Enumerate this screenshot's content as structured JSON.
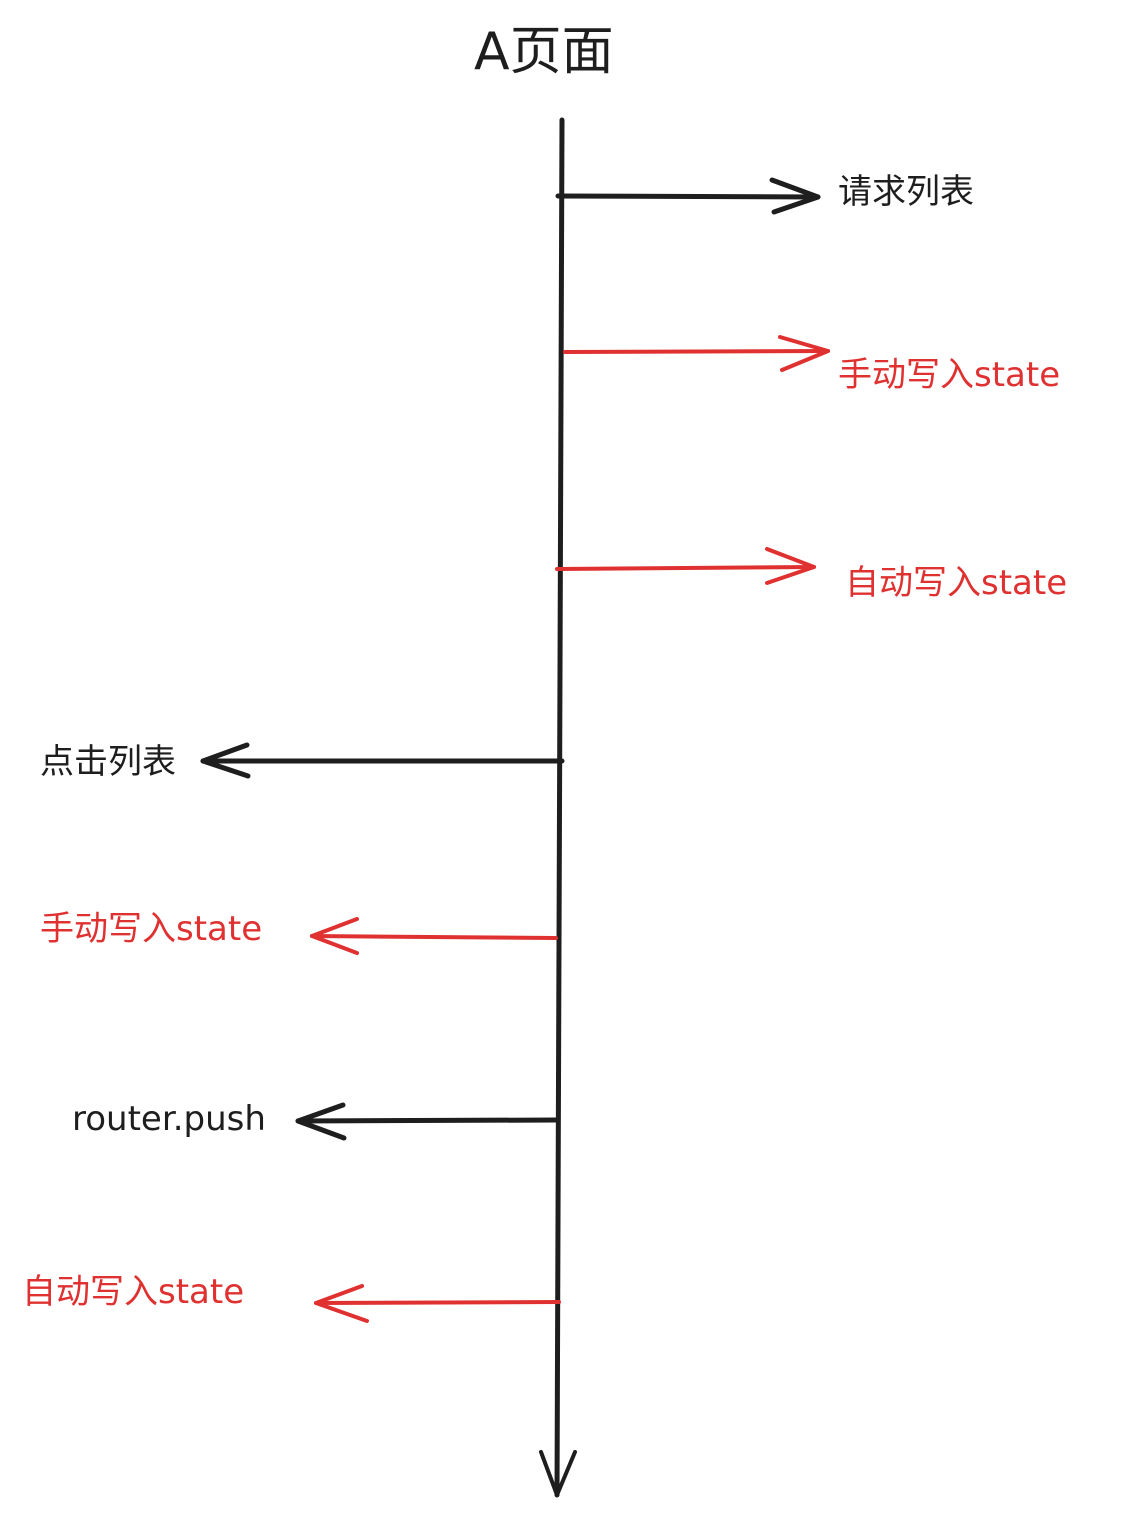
{
  "title": "A页面",
  "colors": {
    "ink": "#1e1e1e",
    "accent": "#e03131"
  },
  "events": [
    {
      "label": "请求列表",
      "direction": "right",
      "color": "black"
    },
    {
      "label": "手动写入state",
      "direction": "right",
      "color": "red"
    },
    {
      "label": "自动写入state",
      "direction": "right",
      "color": "red"
    },
    {
      "label": "点击列表",
      "direction": "left",
      "color": "black"
    },
    {
      "label": "手动写入state",
      "direction": "left",
      "color": "red"
    },
    {
      "label": "router.push",
      "direction": "left",
      "color": "black"
    },
    {
      "label": "自动写入state",
      "direction": "left",
      "color": "red"
    }
  ]
}
